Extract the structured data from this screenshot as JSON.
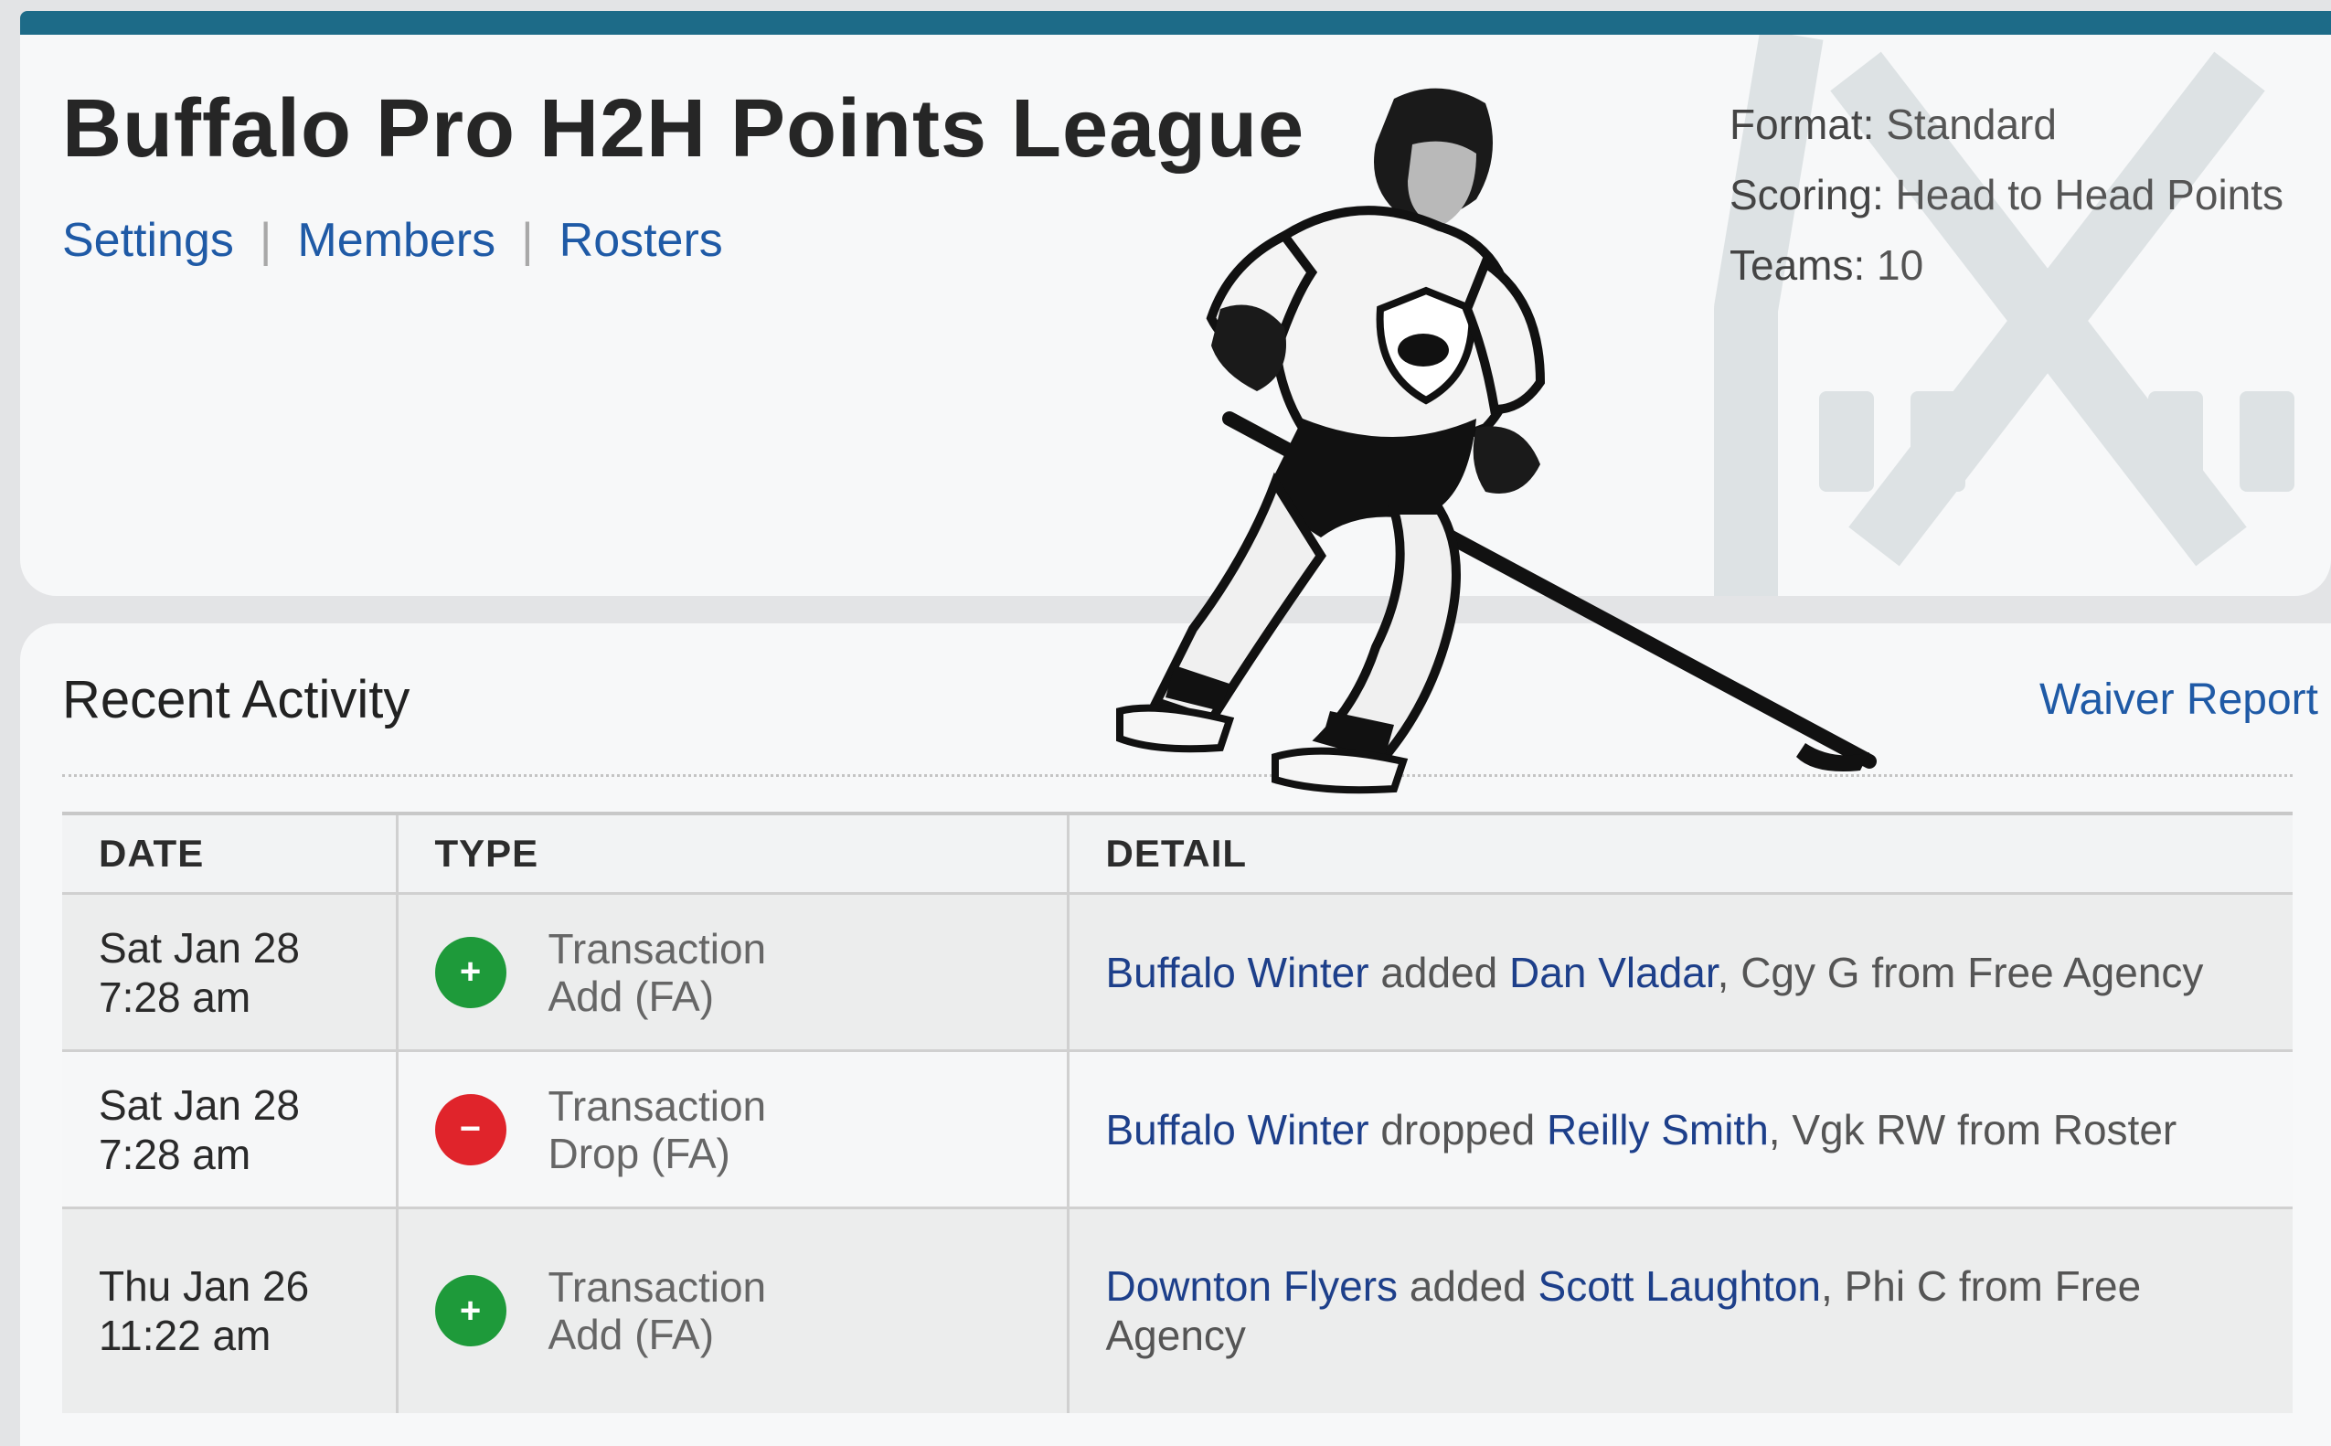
{
  "header": {
    "title": "Buffalo Pro H2H Points League",
    "nav": [
      {
        "label": "Settings"
      },
      {
        "label": "Members"
      },
      {
        "label": "Rosters"
      }
    ],
    "info": [
      {
        "label": "Format:",
        "value": "Standard"
      },
      {
        "label": "Scoring:",
        "value": "Head to Head Points"
      },
      {
        "label": "Teams:",
        "value": "10"
      }
    ]
  },
  "activity": {
    "title": "Recent Activity",
    "waiver_link": "Waiver Report",
    "columns": [
      "DATE",
      "TYPE",
      "DETAIL"
    ],
    "rows": [
      {
        "date_line1": "Sat Jan 28",
        "date_line2": "7:28 am",
        "icon": "plus",
        "type_line1": "Transaction",
        "type_line2": "Add (FA)",
        "team": "Buffalo Winter",
        "action": "added",
        "player": "Dan Vladar",
        "rest": ", Cgy G from Free Agency"
      },
      {
        "date_line1": "Sat Jan 28",
        "date_line2": "7:28 am",
        "icon": "minus",
        "type_line1": "Transaction",
        "type_line2": "Drop (FA)",
        "team": "Buffalo Winter",
        "action": "dropped",
        "player": "Reilly Smith",
        "rest": ", Vgk RW from Roster"
      },
      {
        "date_line1": "Thu Jan 26",
        "date_line2": "11:22 am",
        "icon": "plus",
        "type_line1": "Transaction",
        "type_line2": "Add (FA)",
        "team": "Downton Flyers",
        "action": "added",
        "player": "Scott Laughton",
        "rest": ", Phi C from Free Agency"
      }
    ]
  },
  "icons": {
    "plus": "+",
    "minus": "−"
  },
  "colors": {
    "accent_bar": "#1d6b88",
    "link": "#1f5aa6",
    "add_badge": "#1e9a3a",
    "drop_badge": "#e0242b"
  }
}
